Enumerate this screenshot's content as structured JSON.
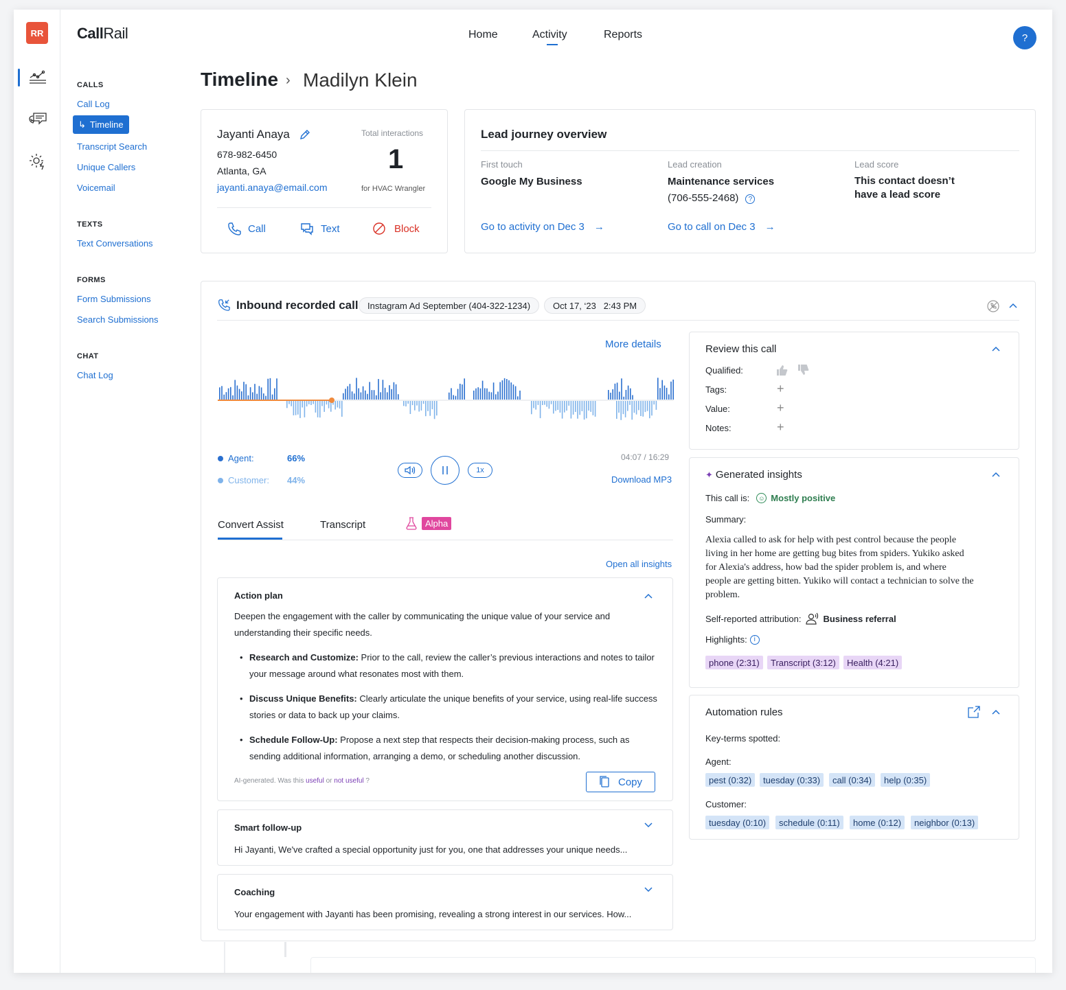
{
  "app": {
    "logo_a": "Call",
    "logo_b": "Rail",
    "avatar": "RR"
  },
  "topnav": {
    "home": "Home",
    "activity": "Activity",
    "reports": "Reports",
    "help": "?"
  },
  "sidebar": {
    "calls_heading": "CALLS",
    "calls": [
      "Call Log",
      "Timeline",
      "Transcript Search",
      "Unique Callers",
      "Voicemail"
    ],
    "texts_heading": "TEXTS",
    "texts": [
      "Text Conversations"
    ],
    "forms_heading": "FORMS",
    "forms": [
      "Form Submissions",
      "Search Submissions"
    ],
    "chat_heading": "CHAT",
    "chat": [
      "Chat Log"
    ]
  },
  "breadcrumb": {
    "title": "Timeline",
    "separator": "›",
    "current": "Madilyn Klein"
  },
  "contact": {
    "name": "Jayanti Anaya",
    "phone": "678-982-6450",
    "location": "Atlanta, GA",
    "email": "jayanti.anaya@email.com",
    "interactions_label": "Total interactions",
    "interactions_count": "1",
    "interactions_sub": "for HVAC Wrangler",
    "actions": {
      "call": "Call",
      "text": "Text",
      "block": "Block"
    }
  },
  "journey": {
    "title": "Lead journey overview",
    "first_touch_label": "First touch",
    "first_touch_value": "Google My Business",
    "first_touch_link": "Go to activity on Dec 3",
    "creation_label": "Lead creation",
    "creation_value": "Maintenance services",
    "creation_phone": "(706-555-2468)",
    "creation_link": "Go to call on Dec 3",
    "score_label": "Lead score",
    "score_value_line1": "This contact doesn’t",
    "score_value_line2": "have a lead score"
  },
  "call": {
    "title": "Inbound recorded call",
    "source_pill": "Instagram Ad September (404-322-1234)",
    "date_pill": "Oct 17, ‘23   2:43 PM",
    "more_details": "More details",
    "agent_label": "Agent:",
    "agent_pct": "66%",
    "customer_label": "Customer:",
    "customer_pct": "44%",
    "time": "04:07 / 16:29",
    "playback_progress": 0.25,
    "speed": "1x",
    "download": "Download MP3"
  },
  "tabs": {
    "convert_assist": "Convert Assist",
    "transcript": "Transcript",
    "alpha": "Alpha"
  },
  "insights_link": "Open all insights",
  "action_plan": {
    "title": "Action plan",
    "intro_line1": "Deepen the engagement with the caller by communicating the unique value of your service and",
    "intro_line2": "understanding their specific needs.",
    "items": [
      {
        "bold": "Research and Customize:",
        "line1": " Prior to the call, review the caller’s previous interactions and notes to tailor",
        "line2": "your message around what resonates most with them."
      },
      {
        "bold": "Discuss Unique Benefits:",
        "line1": " Clearly articulate the unique benefits of your service, using real-life success",
        "line2": "stories or data to back up your claims."
      },
      {
        "bold": "Schedule Follow-Up:",
        "line1": " Propose a next step that respects their decision-making process, such as",
        "line2": "sending additional information, arranging a demo, or scheduling another discussion."
      }
    ],
    "feedback_prefix": "AI-generated. Was this ",
    "feedback_useful": "useful",
    "feedback_or": " or ",
    "feedback_not_useful": "not useful",
    "feedback_q": " ?",
    "copy": "Copy"
  },
  "smart_followup": {
    "title": "Smart follow-up",
    "text": "Hi Jayanti, We've crafted a special opportunity just for you, one that addresses your unique needs..."
  },
  "coaching": {
    "title": "Coaching",
    "text": "Your engagement with Jayanti has been promising, revealing a strong interest in our services. How..."
  },
  "review": {
    "title": "Review this call",
    "qualified": "Qualified:",
    "tags": "Tags:",
    "value": "Value:",
    "notes": "Notes:"
  },
  "generated": {
    "title": "Generated insights",
    "call_is_label": "This call is:",
    "sentiment": "Mostly positive",
    "summary_label": "Summary:",
    "summary_lines": [
      "Alexia called to ask for help with pest control because the people",
      "living in her home are getting bug bites from spiders. Yukiko asked",
      "for Alexia's address, how bad the spider problem is, and where",
      "people are getting bitten. Yukiko will contact a technician to solve the",
      "problem."
    ],
    "attribution_label": "Self-reported attribution:",
    "attribution_value": "Business referral",
    "highlights_label": "Highlights:",
    "highlights": [
      "phone (2:31)",
      "Transcript (3:12)",
      "Health (4:21)"
    ]
  },
  "automation": {
    "title": "Automation rules",
    "key_terms_label": "Key-terms spotted:",
    "agent_label": "Agent:",
    "agent_terms": [
      "pest (0:32)",
      "tuesday (0:33)",
      "call (0:34)",
      "help (0:35)"
    ],
    "customer_label": "Customer:",
    "customer_terms": [
      "tuesday (0:10)",
      "schedule (0:11)",
      "home (0:12)",
      "neighbor (0:13)"
    ]
  },
  "colors": {
    "accent": "#1f6fd1",
    "danger": "#d93025",
    "agent_wave": "#2a6fcf",
    "customer_wave": "#7fb3ea",
    "progress": "#f08a3c",
    "alpha_tag": "#e0479e"
  }
}
